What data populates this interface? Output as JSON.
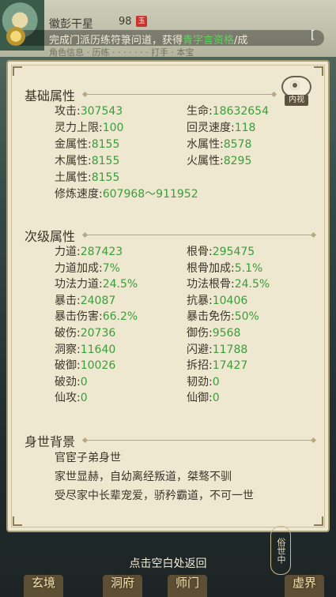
{
  "header": {
    "character_name": "徽彭干星",
    "level": "98",
    "vip_badge": "玉",
    "notice_prefix": "完成门派历练符箓问道，获得",
    "notice_highlight": "青字言资格",
    "notice_suffix": "/成",
    "notice_end_mark": "[",
    "subtabs": "角色信息 · 历练 · · · · · · · 打手 · 本宝"
  },
  "basic": {
    "title": "基础属性",
    "inner_view_label": "内视",
    "stats": [
      {
        "label": "攻击:",
        "value": "307543"
      },
      {
        "label": "生命:",
        "value": "18632654"
      },
      {
        "label": "灵力上限:",
        "value": "100"
      },
      {
        "label": "回灵速度:",
        "value": "118"
      },
      {
        "label": "金属性:",
        "value": "8155"
      },
      {
        "label": "水属性:",
        "value": "8578"
      },
      {
        "label": "木属性:",
        "value": "8155"
      },
      {
        "label": "火属性:",
        "value": "8295"
      },
      {
        "label": "土属性:",
        "value": "8155"
      },
      {
        "label": "修炼速度:",
        "value": "607968～911952"
      }
    ]
  },
  "secondary": {
    "title": "次级属性",
    "stats": [
      {
        "label": "力道:",
        "value": "287423"
      },
      {
        "label": "根骨:",
        "value": "295475"
      },
      {
        "label": "力道加成:",
        "value": "7%"
      },
      {
        "label": "根骨加成:",
        "value": "5.1%"
      },
      {
        "label": "功法力道:",
        "value": "24.5%"
      },
      {
        "label": "功法根骨:",
        "value": "24.5%"
      },
      {
        "label": "暴击:",
        "value": "24087"
      },
      {
        "label": "抗暴:",
        "value": "10406"
      },
      {
        "label": "暴击伤害:",
        "value": "66.2%"
      },
      {
        "label": "暴击免伤:",
        "value": "50%"
      },
      {
        "label": "破伤:",
        "value": "20736"
      },
      {
        "label": "御伤:",
        "value": "9568"
      },
      {
        "label": "洞察:",
        "value": "11640"
      },
      {
        "label": "闪避:",
        "value": "11788"
      },
      {
        "label": "破御:",
        "value": "10026"
      },
      {
        "label": "拆招:",
        "value": "17427"
      },
      {
        "label": "破劲:",
        "value": "0"
      },
      {
        "label": "韧劲:",
        "value": "0"
      },
      {
        "label": "仙攻:",
        "value": "0"
      },
      {
        "label": "仙御:",
        "value": "0"
      }
    ]
  },
  "background": {
    "title": "身世背景",
    "lines": [
      "官宦子弟身世",
      "家世显赫，自幼离经叛道，桀骜不驯",
      "受尽家中长辈宠爱，骄矜霸道，不可一世"
    ]
  },
  "footer": {
    "return_hint": "点击空白处返回",
    "nav": [
      "玄境",
      "洞府",
      "师门",
      "虚界"
    ],
    "side_tag": "俗世中"
  }
}
